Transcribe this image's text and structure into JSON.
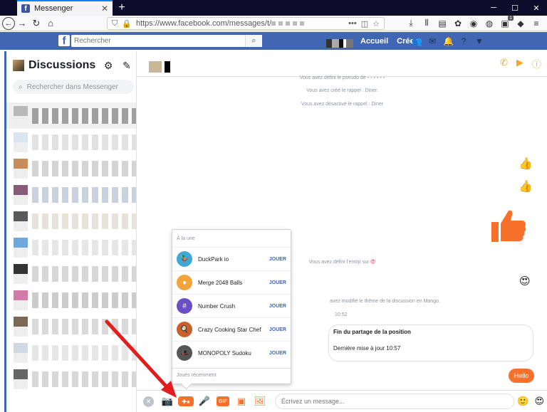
{
  "browser": {
    "tab_title": "Messenger",
    "url": "https://www.facebook.com/messages/t/",
    "new_tab": "+",
    "window_controls": [
      "─",
      "☐",
      "✕"
    ]
  },
  "facebook": {
    "search_placeholder": "Rechercher",
    "links": [
      "Accueil",
      "Créer"
    ]
  },
  "discussions": {
    "title": "Discussions",
    "search_placeholder": "Rechercher dans Messenger",
    "conversations": [
      {
        "av": "#b9b9b9",
        "blur": "#6a6a6a"
      },
      {
        "av": "#d9e6f2",
        "blur": "#cfcfcf"
      },
      {
        "av": "#c88b5a",
        "blur": "#b7b7b7"
      },
      {
        "av": "#8a5a7a",
        "blur": "#a3b5c9"
      },
      {
        "av": "#5a5a5a",
        "blur": "#d8d0c0"
      },
      {
        "av": "#6fa8dc",
        "blur": "#d6d6d6"
      },
      {
        "av": "#333333",
        "blur": "#bcbcbc"
      },
      {
        "av": "#d27aa8",
        "blur": "#aaaaaa"
      },
      {
        "av": "#7a6a55",
        "blur": "#c2c2c2"
      },
      {
        "av": "#cfd8e3",
        "blur": "#d6d6d6"
      },
      {
        "av": "#666666",
        "blur": "#bdbdbd"
      }
    ]
  },
  "messages": {
    "system": [
      "Vous avez défini le pseudo de",
      "Vous avez créé le rappel : Diner.",
      "Vous avez désactivé le rappel : Diner",
      "Vous avez défini l'emoji sur",
      "avez modifié le thème de la discussion en Mango."
    ],
    "time": "10:52",
    "location_title": "Fin du partage de la position",
    "location_sub": "Dernière mise à jour 10:57",
    "hello": "Hello"
  },
  "composer": {
    "placeholder": "Écrivez un message...",
    "gif": "GIF"
  },
  "games": {
    "section_featured": "À la une",
    "section_recent": "Joués récemment",
    "play_label": "JOUER",
    "items": [
      {
        "name": "DuckPark io",
        "color": "#3fa9d6",
        "glyph": "🦆"
      },
      {
        "name": "Merge 2048 Balls",
        "color": "#f2a33a",
        "glyph": "●"
      },
      {
        "name": "Number Crush",
        "color": "#6a4fc7",
        "glyph": "#"
      },
      {
        "name": "Crazy Cooking Star Chef",
        "color": "#c9602b",
        "glyph": "🍳"
      },
      {
        "name": "MONOPOLY Sudoku",
        "color": "#555555",
        "glyph": "🎩"
      }
    ]
  },
  "colors": {
    "accent": "#f7712a",
    "fb_blue": "#4267b2",
    "arrow": "#e11d1d"
  }
}
